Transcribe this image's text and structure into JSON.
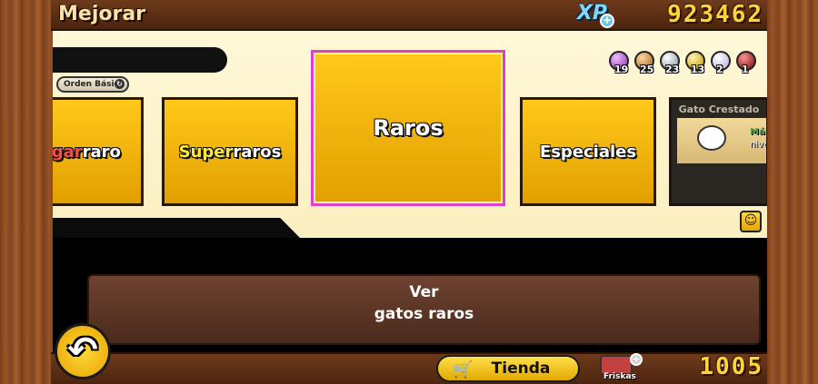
{
  "header": {
    "title": "Mejorar",
    "xp_label": "XP",
    "xp_value": "923462"
  },
  "sort": {
    "label": "Orden Básico"
  },
  "orbs": [
    {
      "count": "19",
      "color": "#b060c8"
    },
    {
      "count": "25",
      "color": "#c0782a"
    },
    {
      "count": "23",
      "color": "#a9b8c8"
    },
    {
      "count": "13",
      "color": "#e2b22a"
    },
    {
      "count": "2",
      "color": "#e8e0f0"
    },
    {
      "count": "1",
      "color": "#a02020"
    }
  ],
  "categories": {
    "legendary": {
      "highlight": "Legar",
      "rest": "raro"
    },
    "superrare": {
      "highlight": "Super",
      "rest": "raros"
    },
    "selected": "Raros",
    "special": "Especiales"
  },
  "featured": {
    "title": "Gato Crestado",
    "badge": "Máx.",
    "level": "nivel"
  },
  "info": {
    "line1": "Ver",
    "line2": "gatos raros"
  },
  "footer": {
    "shop_label": "Tienda",
    "currency_label": "Friskas",
    "currency_value": "1005"
  },
  "colors": {
    "accent_gold": "#ffc81a",
    "selected_border": "#e040c8",
    "wood": "#8a4a22"
  }
}
